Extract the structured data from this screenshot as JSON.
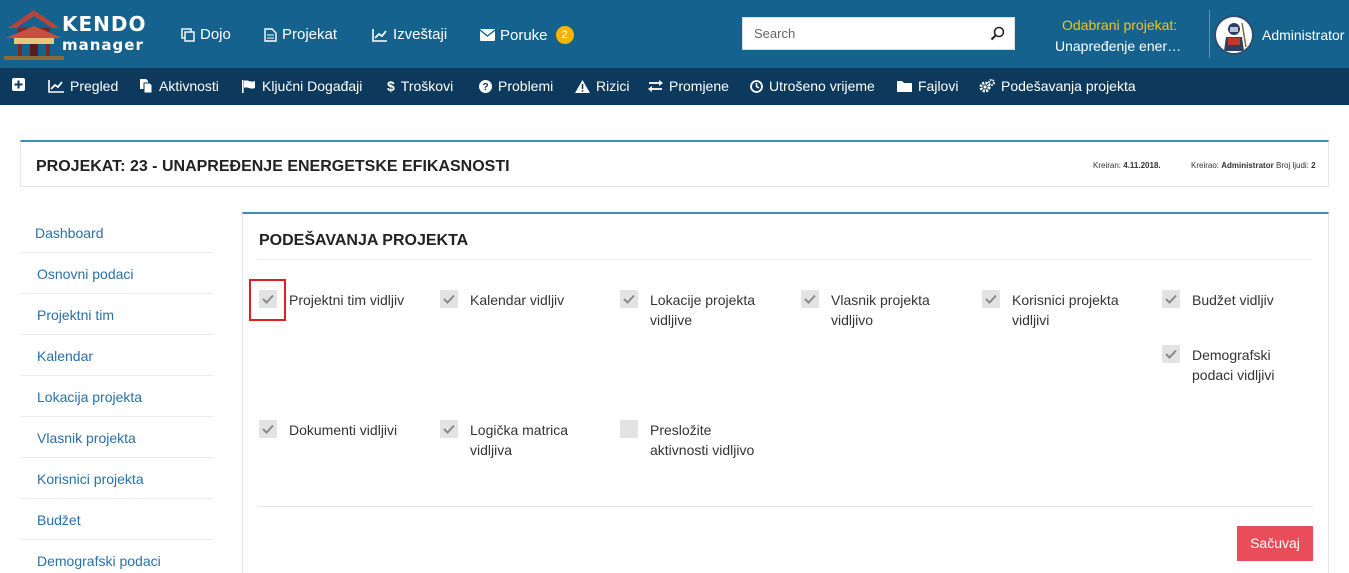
{
  "header": {
    "logo_line1": "KENDO",
    "logo_line2": "manager",
    "nav": [
      {
        "label": "Dojo",
        "icon": "copy-icon"
      },
      {
        "label": "Projekat",
        "icon": "document-icon"
      },
      {
        "label": "Izveštaji",
        "icon": "line-chart-icon"
      },
      {
        "label": "Poruke",
        "icon": "envelope-icon",
        "badge": "2"
      }
    ],
    "search_placeholder": "Search",
    "selected_project_label": "Odabrani projekat:",
    "selected_project_name": "Unapređenje ener…",
    "user_name": "Administrator"
  },
  "subnav": [
    {
      "label": "",
      "icon": "plus-square-icon"
    },
    {
      "label": "Pregled",
      "icon": "area-chart-icon"
    },
    {
      "label": "Aktivnosti",
      "icon": "files-icon"
    },
    {
      "label": "Ključni Događaji",
      "icon": "flag-icon"
    },
    {
      "label": "Troškovi",
      "icon": "dollar-icon"
    },
    {
      "label": "Problemi",
      "icon": "question-circle-icon"
    },
    {
      "label": "Rizici",
      "icon": "warning-icon"
    },
    {
      "label": "Promjene",
      "icon": "exchange-icon"
    },
    {
      "label": "Utrošeno vrijeme",
      "icon": "clock-icon"
    },
    {
      "label": "Fajlovi",
      "icon": "folder-icon"
    },
    {
      "label": "Podešavanja projekta",
      "icon": "cogs-icon"
    }
  ],
  "project": {
    "title": "PROJEKAT: 23 - UNAPREĐENJE ENERGETSKE EFIKASNOSTI",
    "created_label": "Kreiran:",
    "created_value": "4.11.2018.",
    "creator_label": "Kreirao:",
    "creator_value": "Administrator",
    "people_label": "Broj ljudi:",
    "people_value": "2"
  },
  "sidebar": [
    {
      "label": "Dashboard"
    },
    {
      "label": "Osnovni podaci"
    },
    {
      "label": "Projektni tim"
    },
    {
      "label": "Kalendar"
    },
    {
      "label": "Lokacija projekta"
    },
    {
      "label": "Vlasnik projekta"
    },
    {
      "label": "Korisnici projekta"
    },
    {
      "label": "Budžet"
    },
    {
      "label": "Demografski podaci"
    }
  ],
  "settings": {
    "title": "PODEŠAVANJA PROJEKTA",
    "options": [
      {
        "line1": "Projektni tim vidljiv",
        "line2": "",
        "checked": true
      },
      {
        "line1": "Kalendar vidljiv",
        "line2": "",
        "checked": true
      },
      {
        "line1": "Lokacije projekta",
        "line2": "vidljive",
        "checked": true
      },
      {
        "line1": "Vlasnik projekta",
        "line2": "vidljivo",
        "checked": true
      },
      {
        "line1": "Korisnici projekta",
        "line2": "vidljivi",
        "checked": true
      },
      {
        "line1": "Budžet vidljiv",
        "line2": "",
        "checked": true
      },
      {
        "line1": "Demografski",
        "line2": "podaci vidljivi",
        "checked": true
      },
      {
        "line1": "Dokumenti vidljivi",
        "line2": "",
        "checked": true
      },
      {
        "line1": "Logička matrica",
        "line2": "vidljiva",
        "checked": true
      },
      {
        "line1": "Presložite",
        "line2": "aktivnosti vidljivo",
        "checked": false
      }
    ],
    "save_label": "Sačuvaj"
  },
  "colors": {
    "topbar": "#16628f",
    "subnav": "#0d3a5c",
    "accent": "#3c8dbc",
    "link": "#2a6fa8",
    "save_button": "#e94d5a",
    "highlight": "#e02020",
    "selected_project_label": "#f0c419"
  }
}
